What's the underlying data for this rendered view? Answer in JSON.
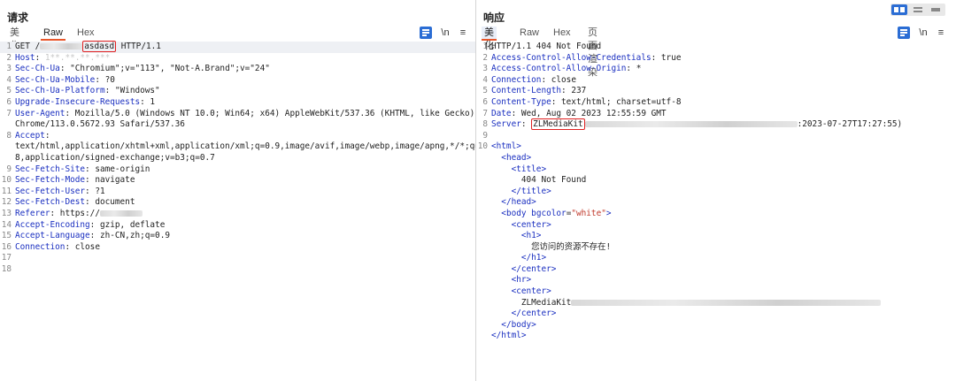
{
  "request": {
    "title": "请求",
    "tabs": [
      "美化",
      "Raw",
      "Hex"
    ],
    "active_tab": "Raw",
    "lines": [
      {
        "n": "1",
        "parts": [
          {
            "t": "GET /"
          },
          {
            "t": "blur",
            "blur": true
          },
          {
            "t": "asdasd",
            "box": true
          },
          {
            "t": " HTTP/1.1"
          }
        ]
      },
      {
        "n": "2",
        "parts": [
          {
            "t": "Host",
            "k": true
          },
          {
            "t": ": "
          },
          {
            "t": "1**.**.**.***",
            "blurtext": true
          }
        ]
      },
      {
        "n": "3",
        "parts": [
          {
            "t": "Sec-Ch-Ua",
            "k": true
          },
          {
            "t": ": \"Chromium\";v=\"113\", \"Not-A.Brand\";v=\"24\""
          }
        ]
      },
      {
        "n": "4",
        "parts": [
          {
            "t": "Sec-Ch-Ua-Mobile",
            "k": true
          },
          {
            "t": ": ?0"
          }
        ]
      },
      {
        "n": "5",
        "parts": [
          {
            "t": "Sec-Ch-Ua-Platform",
            "k": true
          },
          {
            "t": ": \"Windows\""
          }
        ]
      },
      {
        "n": "6",
        "parts": [
          {
            "t": "Upgrade-Insecure-Requests",
            "k": true
          },
          {
            "t": ": 1"
          }
        ]
      },
      {
        "n": "7",
        "parts": [
          {
            "t": "User-Agent",
            "k": true
          },
          {
            "t": ": Mozilla/5.0 (Windows NT 10.0; Win64; x64) AppleWebKit/537.36 (KHTML, like Gecko)"
          }
        ]
      },
      {
        "n": "",
        "parts": [
          {
            "t": "Chrome/113.0.5672.93 Safari/537.36"
          }
        ]
      },
      {
        "n": "8",
        "parts": [
          {
            "t": "Accept",
            "k": true
          },
          {
            "t": ":"
          }
        ]
      },
      {
        "n": "",
        "parts": [
          {
            "t": "text/html,application/xhtml+xml,application/xml;q=0.9,image/avif,image/webp,image/apng,*/*;q=0."
          }
        ]
      },
      {
        "n": "",
        "parts": [
          {
            "t": "8,application/signed-exchange;v=b3;q=0.7"
          }
        ]
      },
      {
        "n": "9",
        "parts": [
          {
            "t": "Sec-Fetch-Site",
            "k": true
          },
          {
            "t": ": same-origin"
          }
        ]
      },
      {
        "n": "10",
        "parts": [
          {
            "t": "Sec-Fetch-Mode",
            "k": true
          },
          {
            "t": ": navigate"
          }
        ]
      },
      {
        "n": "11",
        "parts": [
          {
            "t": "Sec-Fetch-User",
            "k": true
          },
          {
            "t": ": ?1"
          }
        ]
      },
      {
        "n": "12",
        "parts": [
          {
            "t": "Sec-Fetch-Dest",
            "k": true
          },
          {
            "t": ": document"
          }
        ]
      },
      {
        "n": "13",
        "parts": [
          {
            "t": "Referer",
            "k": true
          },
          {
            "t": ": https://"
          },
          {
            "t": "blur",
            "blur": true
          }
        ]
      },
      {
        "n": "14",
        "parts": [
          {
            "t": "Accept-Encoding",
            "k": true
          },
          {
            "t": ": gzip, deflate"
          }
        ]
      },
      {
        "n": "15",
        "parts": [
          {
            "t": "Accept-Language",
            "k": true
          },
          {
            "t": ": zh-CN,zh;q=0.9"
          }
        ]
      },
      {
        "n": "16",
        "parts": [
          {
            "t": "Connection",
            "k": true
          },
          {
            "t": ": close"
          }
        ]
      },
      {
        "n": "17",
        "parts": []
      },
      {
        "n": "18",
        "parts": []
      }
    ]
  },
  "response": {
    "title": "响应",
    "tabs": [
      "美化",
      "Raw",
      "Hex",
      "页面渲染"
    ],
    "active_tab": "美化",
    "lines": [
      {
        "n": "1",
        "parts": [
          {
            "t": "HTTP/1.1 404 Not Found"
          }
        ]
      },
      {
        "n": "2",
        "parts": [
          {
            "t": "Access-Control-Allow-Credentials",
            "k": true
          },
          {
            "t": ": true"
          }
        ]
      },
      {
        "n": "3",
        "parts": [
          {
            "t": "Access-Control-Allow-Origin",
            "k": true
          },
          {
            "t": ": *"
          }
        ]
      },
      {
        "n": "4",
        "parts": [
          {
            "t": "Connection",
            "k": true
          },
          {
            "t": ": close"
          }
        ]
      },
      {
        "n": "5",
        "parts": [
          {
            "t": "Content-Length",
            "k": true
          },
          {
            "t": ": 237"
          }
        ]
      },
      {
        "n": "6",
        "parts": [
          {
            "t": "Content-Type",
            "k": true
          },
          {
            "t": ": text/html; charset=utf-8"
          }
        ]
      },
      {
        "n": "7",
        "parts": [
          {
            "t": "Date",
            "k": true
          },
          {
            "t": ": Wed, Aug 02 2023 12:55:59 GMT"
          }
        ]
      },
      {
        "n": "8",
        "parts": [
          {
            "t": "Server",
            "k": true
          },
          {
            "t": ": "
          },
          {
            "t": "ZLMediaKit",
            "box": true
          },
          {
            "t": "blur",
            "blur": true,
            "w": 240
          },
          {
            "t": ":2023-07-27T17:27:55)"
          }
        ]
      },
      {
        "n": "9",
        "parts": []
      },
      {
        "n": "10",
        "parts": [
          {
            "t": "<html>",
            "tag": true
          }
        ]
      },
      {
        "n": "",
        "parts": [
          {
            "t": "  "
          },
          {
            "t": "<head>",
            "tag": true
          }
        ]
      },
      {
        "n": "",
        "parts": [
          {
            "t": "    "
          },
          {
            "t": "<title>",
            "tag": true
          }
        ]
      },
      {
        "n": "",
        "parts": [
          {
            "t": "      404 Not Found"
          }
        ]
      },
      {
        "n": "",
        "parts": [
          {
            "t": "    "
          },
          {
            "t": "</title>",
            "tag": true
          }
        ]
      },
      {
        "n": "",
        "parts": [
          {
            "t": "  "
          },
          {
            "t": "</head>",
            "tag": true
          }
        ]
      },
      {
        "n": "",
        "parts": [
          {
            "t": "  "
          },
          {
            "t": "<body ",
            "tag": true
          },
          {
            "t": "bgcolor",
            "attr": true
          },
          {
            "t": "="
          },
          {
            "t": "\"white\"",
            "str": true
          },
          {
            "t": ">",
            "tag": true
          }
        ]
      },
      {
        "n": "",
        "parts": [
          {
            "t": "    "
          },
          {
            "t": "<center>",
            "tag": true
          }
        ]
      },
      {
        "n": "",
        "parts": [
          {
            "t": "      "
          },
          {
            "t": "<h1>",
            "tag": true
          }
        ]
      },
      {
        "n": "",
        "parts": [
          {
            "t": "        您访问的资源不存在!"
          }
        ]
      },
      {
        "n": "",
        "parts": [
          {
            "t": "      "
          },
          {
            "t": "</h1>",
            "tag": true
          }
        ]
      },
      {
        "n": "",
        "parts": [
          {
            "t": "    "
          },
          {
            "t": "</center>",
            "tag": true
          }
        ]
      },
      {
        "n": "",
        "parts": [
          {
            "t": "    "
          },
          {
            "t": "<hr>",
            "tag": true
          }
        ]
      },
      {
        "n": "",
        "parts": [
          {
            "t": "    "
          },
          {
            "t": "<center>",
            "tag": true
          }
        ]
      },
      {
        "n": "",
        "parts": [
          {
            "t": "      ZLMediaKit"
          },
          {
            "t": "blur",
            "blur": true,
            "w": 350
          }
        ]
      },
      {
        "n": "",
        "parts": [
          {
            "t": "    "
          },
          {
            "t": "</center>",
            "tag": true
          }
        ]
      },
      {
        "n": "",
        "parts": [
          {
            "t": "  "
          },
          {
            "t": "</body>",
            "tag": true
          }
        ]
      },
      {
        "n": "",
        "parts": [
          {
            "t": "</html>",
            "tag": true
          }
        ]
      }
    ]
  },
  "toolbar": {
    "newline_label": "\\n",
    "menu_label": "≡"
  },
  "colors": {
    "accent": "#e8572b",
    "header_key": "#1a2fc0",
    "string": "#c0392b",
    "highlight_box": "#e02020",
    "layout_on": "#2b6dd4"
  }
}
